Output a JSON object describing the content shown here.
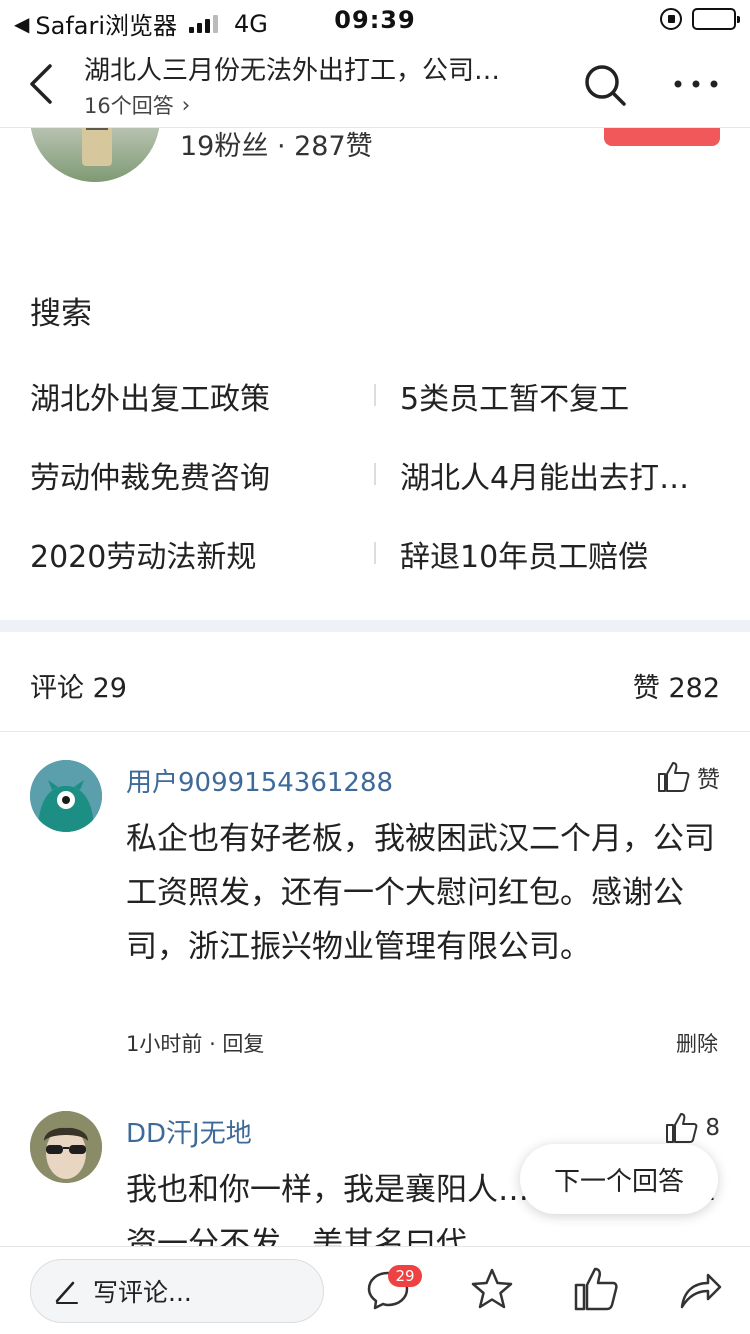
{
  "status_bar": {
    "back_label": "◀",
    "app": "Safari浏览器",
    "network": "4G",
    "time": "09:39"
  },
  "nav": {
    "title": "湖北人三月份无法外出打工，公司…",
    "subtitle": "16个回答",
    "subtitle_chevron": "›"
  },
  "author": {
    "stats": "19粉丝 · 287赞"
  },
  "search": {
    "title": "搜索",
    "items": [
      "湖北外出复工政策",
      "5类员工暂不复工",
      "劳动仲裁免费咨询",
      "湖北人4月能出去打…",
      "2020劳动法新规",
      "辞退10年员工赔偿"
    ]
  },
  "comments_header": {
    "comments": "评论 29",
    "likes": "赞 282"
  },
  "comments": [
    {
      "user": "用户9099154361288",
      "like_label": "赞",
      "text": "私企也有好老板，我被困武汉二个月，公司工资照发，还有一个大慰问红包。感谢公司，浙江振兴物业管理有限公司。",
      "time": "1小时前",
      "reply": "回复",
      "delete": "删除"
    },
    {
      "user": "DD汗J无地",
      "like_label": "8",
      "text": "我也和你一样，我是襄阳人…工，一月份工资一分不发，美其名曰代…"
    }
  ],
  "next_answer": "下一个回答",
  "bottom_bar": {
    "write_placeholder": "写评论...",
    "comment_badge": "29"
  },
  "colors": {
    "username": "#3e6a9a",
    "follow_button": "#f1585a",
    "badge": "#f04142",
    "section_gap": "#eef1f5"
  }
}
